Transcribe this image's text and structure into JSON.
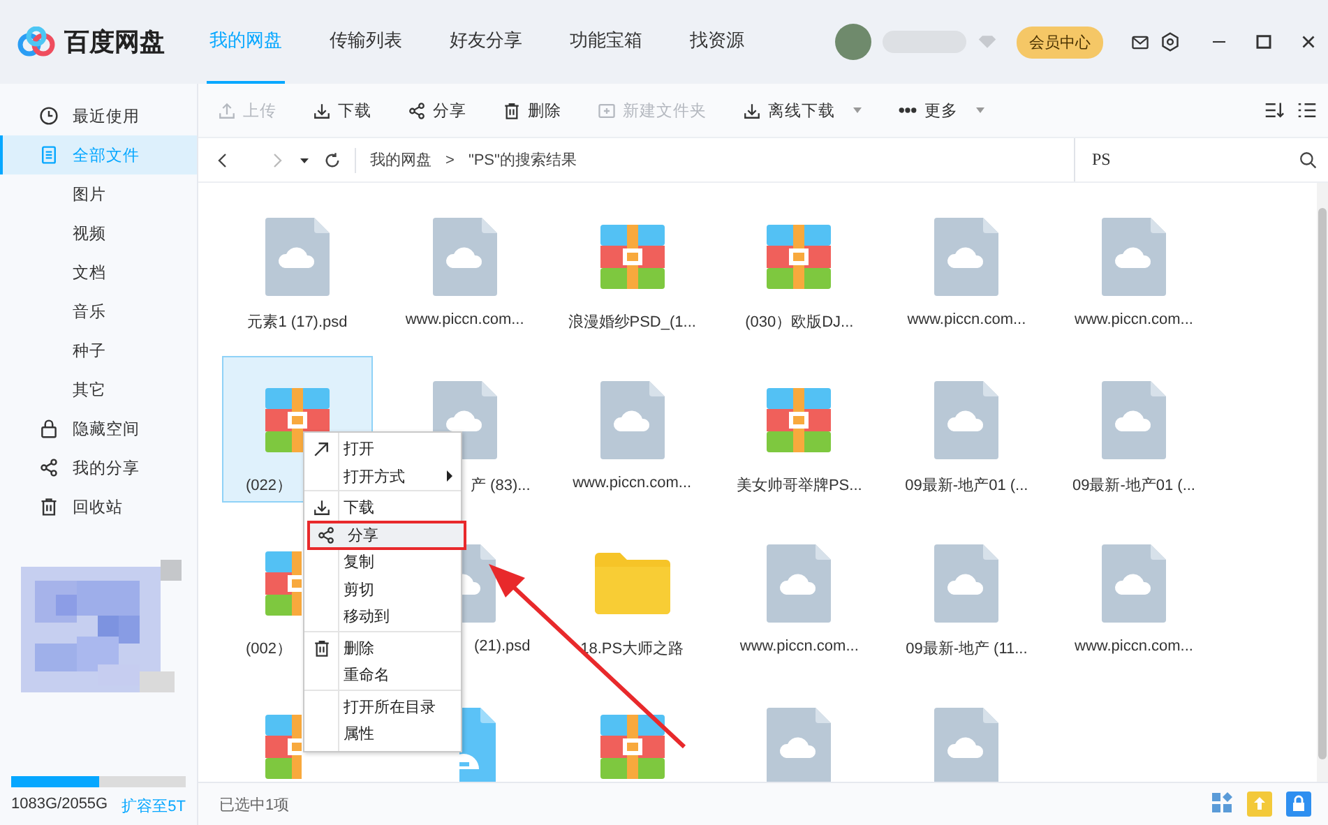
{
  "logo": {
    "text": "百度网盘"
  },
  "tabs": [
    {
      "label": "我的网盘",
      "selected": true
    },
    {
      "label": "传输列表",
      "selected": false
    },
    {
      "label": "好友分享",
      "selected": false
    },
    {
      "label": "功能宝箱",
      "selected": false
    },
    {
      "label": "找资源",
      "selected": false
    }
  ],
  "account": {
    "vip_button": "会员中心"
  },
  "sidebar": {
    "items": [
      {
        "label": "最近使用",
        "kind": "recent",
        "selected": false
      },
      {
        "label": "全部文件",
        "kind": "files",
        "selected": true
      },
      {
        "label": "图片",
        "kind": "sub",
        "selected": false
      },
      {
        "label": "视频",
        "kind": "sub",
        "selected": false
      },
      {
        "label": "文档",
        "kind": "sub",
        "selected": false
      },
      {
        "label": "音乐",
        "kind": "sub",
        "selected": false
      },
      {
        "label": "种子",
        "kind": "sub",
        "selected": false
      },
      {
        "label": "其它",
        "kind": "sub",
        "selected": false
      },
      {
        "label": "隐藏空间",
        "kind": "lock",
        "selected": false
      },
      {
        "label": "我的分享",
        "kind": "share",
        "selected": false
      },
      {
        "label": "回收站",
        "kind": "trash",
        "selected": false
      }
    ],
    "storage": {
      "level": 0.5,
      "reading": "1083G/2055G",
      "link": "扩容至5T"
    }
  },
  "toolbar": {
    "items": [
      {
        "label": "上传",
        "kind": "upload",
        "disabled": true,
        "dropdown": false
      },
      {
        "label": "下载",
        "kind": "download",
        "disabled": false,
        "dropdown": false
      },
      {
        "label": "分享",
        "kind": "share",
        "disabled": false,
        "dropdown": false
      },
      {
        "label": "删除",
        "kind": "delete",
        "disabled": false,
        "dropdown": false
      },
      {
        "label": "新建文件夹",
        "kind": "new-folder",
        "disabled": true,
        "dropdown": false
      },
      {
        "label": "离线下载",
        "kind": "download",
        "disabled": false,
        "dropdown": true
      },
      {
        "label": "更多",
        "kind": "more",
        "disabled": false,
        "dropdown": true
      }
    ]
  },
  "breadcrumb": {
    "path": [
      "我的网盘",
      "\"PS\"的搜索结果"
    ],
    "separator": ">"
  },
  "search": {
    "value": "PS"
  },
  "files": [
    {
      "label": "元素1 (17).psd",
      "kind": "cloud",
      "selected": false,
      "label_cut_right": false,
      "label_cut_left": false,
      "icon_cut_right": false,
      "icon_cut_left": false
    },
    {
      "label": "www.piccn.com...",
      "kind": "cloud",
      "selected": false,
      "label_cut_right": false,
      "label_cut_left": false,
      "icon_cut_right": false,
      "icon_cut_left": false
    },
    {
      "label": "浪漫婚纱PSD_(1...",
      "kind": "zip",
      "selected": false,
      "label_cut_right": false,
      "label_cut_left": false,
      "icon_cut_right": false,
      "icon_cut_left": false
    },
    {
      "label": "(030）欧版DJ...",
      "kind": "zip",
      "selected": false,
      "label_cut_right": false,
      "label_cut_left": false,
      "icon_cut_right": false,
      "icon_cut_left": false
    },
    {
      "label": "www.piccn.com...",
      "kind": "cloud",
      "selected": false,
      "label_cut_right": false,
      "label_cut_left": false,
      "icon_cut_right": false,
      "icon_cut_left": false
    },
    {
      "label": "www.piccn.com...",
      "kind": "cloud",
      "selected": false,
      "label_cut_right": false,
      "label_cut_left": false,
      "icon_cut_right": false,
      "icon_cut_left": false
    },
    {
      "label": "(022）",
      "kind": "zip",
      "selected": true,
      "label_cut_right": true,
      "label_cut_left": false,
      "icon_cut_right": false,
      "icon_cut_left": false
    },
    {
      "label": "产 (83)...",
      "kind": "cloud",
      "selected": false,
      "label_cut_right": false,
      "label_cut_left": true,
      "icon_cut_right": false,
      "icon_cut_left": false
    },
    {
      "label": "www.piccn.com...",
      "kind": "cloud",
      "selected": false,
      "label_cut_right": false,
      "label_cut_left": false,
      "icon_cut_right": false,
      "icon_cut_left": false
    },
    {
      "label": "美女帅哥举牌PS...",
      "kind": "zip",
      "selected": false,
      "label_cut_right": false,
      "label_cut_left": false,
      "icon_cut_right": false,
      "icon_cut_left": false
    },
    {
      "label": "09最新-地产01 (...",
      "kind": "cloud",
      "selected": false,
      "label_cut_right": false,
      "label_cut_left": false,
      "icon_cut_right": false,
      "icon_cut_left": false
    },
    {
      "label": "09最新-地产01 (...",
      "kind": "cloud",
      "selected": false,
      "label_cut_right": false,
      "label_cut_left": false,
      "icon_cut_right": false,
      "icon_cut_left": false
    },
    {
      "label": "(002）",
      "kind": "zip",
      "selected": false,
      "label_cut_right": true,
      "label_cut_left": false,
      "icon_cut_right": true,
      "icon_cut_left": false
    },
    {
      "label": "(21).psd",
      "kind": "cloud",
      "selected": false,
      "label_cut_right": false,
      "label_cut_left": true,
      "icon_cut_right": false,
      "icon_cut_left": true
    },
    {
      "label": "18.PS大师之路",
      "kind": "folder",
      "selected": false,
      "label_cut_right": false,
      "label_cut_left": false,
      "icon_cut_right": false,
      "icon_cut_left": false
    },
    {
      "label": "www.piccn.com...",
      "kind": "cloud",
      "selected": false,
      "label_cut_right": false,
      "label_cut_left": false,
      "icon_cut_right": false,
      "icon_cut_left": false
    },
    {
      "label": "09最新-地产 (11...",
      "kind": "cloud",
      "selected": false,
      "label_cut_right": false,
      "label_cut_left": false,
      "icon_cut_right": false,
      "icon_cut_left": false
    },
    {
      "label": "www.piccn.com...",
      "kind": "cloud",
      "selected": false,
      "label_cut_right": false,
      "label_cut_left": false,
      "icon_cut_right": false,
      "icon_cut_left": false
    },
    {
      "kind": "zip",
      "selected": false,
      "icon_cut_right": true,
      "icon_cut_left": false
    },
    {
      "kind": "disk",
      "selected": false,
      "icon_cut_right": false,
      "icon_cut_left": true
    },
    {
      "kind": "zip",
      "selected": false,
      "icon_cut_right": false,
      "icon_cut_left": false
    },
    {
      "kind": "cloud",
      "selected": false,
      "icon_cut_right": false,
      "icon_cut_left": false
    },
    {
      "kind": "cloud",
      "selected": false,
      "icon_cut_right": false,
      "icon_cut_left": false
    }
  ],
  "context_menu": {
    "items": [
      {
        "label": "打开",
        "kind": "open",
        "submenu": false,
        "highlighted": false,
        "divider_after": false
      },
      {
        "label": "打开方式",
        "kind": "plain",
        "submenu": true,
        "highlighted": false,
        "divider_after": true
      },
      {
        "label": "下载",
        "kind": "download",
        "submenu": false,
        "highlighted": false,
        "divider_after": false
      },
      {
        "label": "分享",
        "kind": "share",
        "submenu": false,
        "highlighted": true,
        "divider_after": false
      },
      {
        "label": "复制",
        "kind": "plain",
        "submenu": false,
        "highlighted": false,
        "divider_after": false
      },
      {
        "label": "剪切",
        "kind": "plain",
        "submenu": false,
        "highlighted": false,
        "divider_after": false
      },
      {
        "label": "移动到",
        "kind": "plain",
        "submenu": false,
        "highlighted": false,
        "divider_after": true
      },
      {
        "label": "删除",
        "kind": "delete",
        "submenu": false,
        "highlighted": false,
        "divider_after": false
      },
      {
        "label": "重命名",
        "kind": "plain",
        "submenu": false,
        "highlighted": false,
        "divider_after": true
      },
      {
        "label": "打开所在目录",
        "kind": "plain",
        "submenu": false,
        "highlighted": false,
        "divider_after": false
      },
      {
        "label": "属性",
        "kind": "plain",
        "submenu": false,
        "highlighted": false,
        "divider_after": false
      }
    ]
  },
  "status_bar": {
    "text": "已选中1项"
  }
}
